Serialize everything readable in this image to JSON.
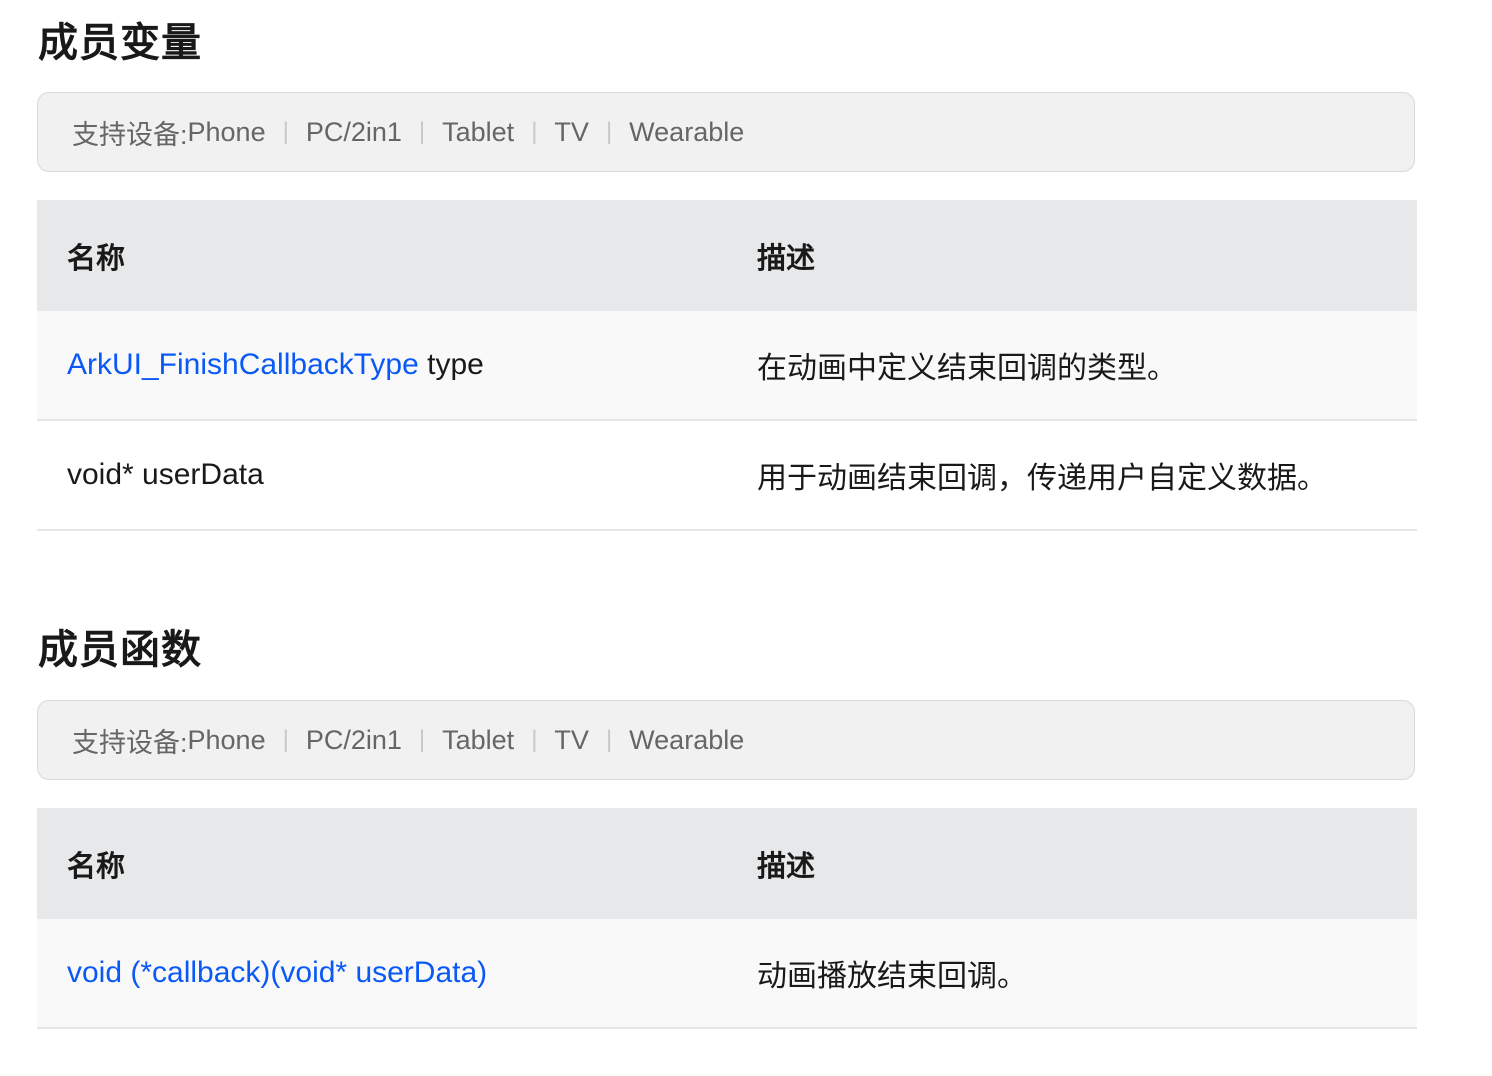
{
  "sections": [
    {
      "title": "成员变量",
      "support": {
        "label": "支持设备: ",
        "devices": [
          "Phone",
          "PC/2in1",
          "Tablet",
          "TV",
          "Wearable"
        ]
      },
      "headers": [
        "名称",
        "描述"
      ],
      "rows": [
        {
          "link": "ArkUI_FinishCallbackType",
          "name_rest": " type",
          "desc": "在动画中定义结束回调的类型。"
        },
        {
          "link": "",
          "name_rest": "void* userData",
          "desc": "用于动画结束回调，传递用户自定义数据。"
        }
      ]
    },
    {
      "title": "成员函数",
      "support": {
        "label": "支持设备: ",
        "devices": [
          "Phone",
          "PC/2in1",
          "Tablet",
          "TV",
          "Wearable"
        ]
      },
      "headers": [
        "名称",
        "描述"
      ],
      "rows": [
        {
          "link": "void (*callback)(void* userData)",
          "name_rest": "",
          "desc": "动画播放结束回调。"
        }
      ]
    }
  ],
  "colors": {
    "link": "#0a59f7",
    "header_bg": "#e7e8ea",
    "support_bg": "#f1f1f2",
    "row_alt_bg": "#f9f9f9"
  }
}
